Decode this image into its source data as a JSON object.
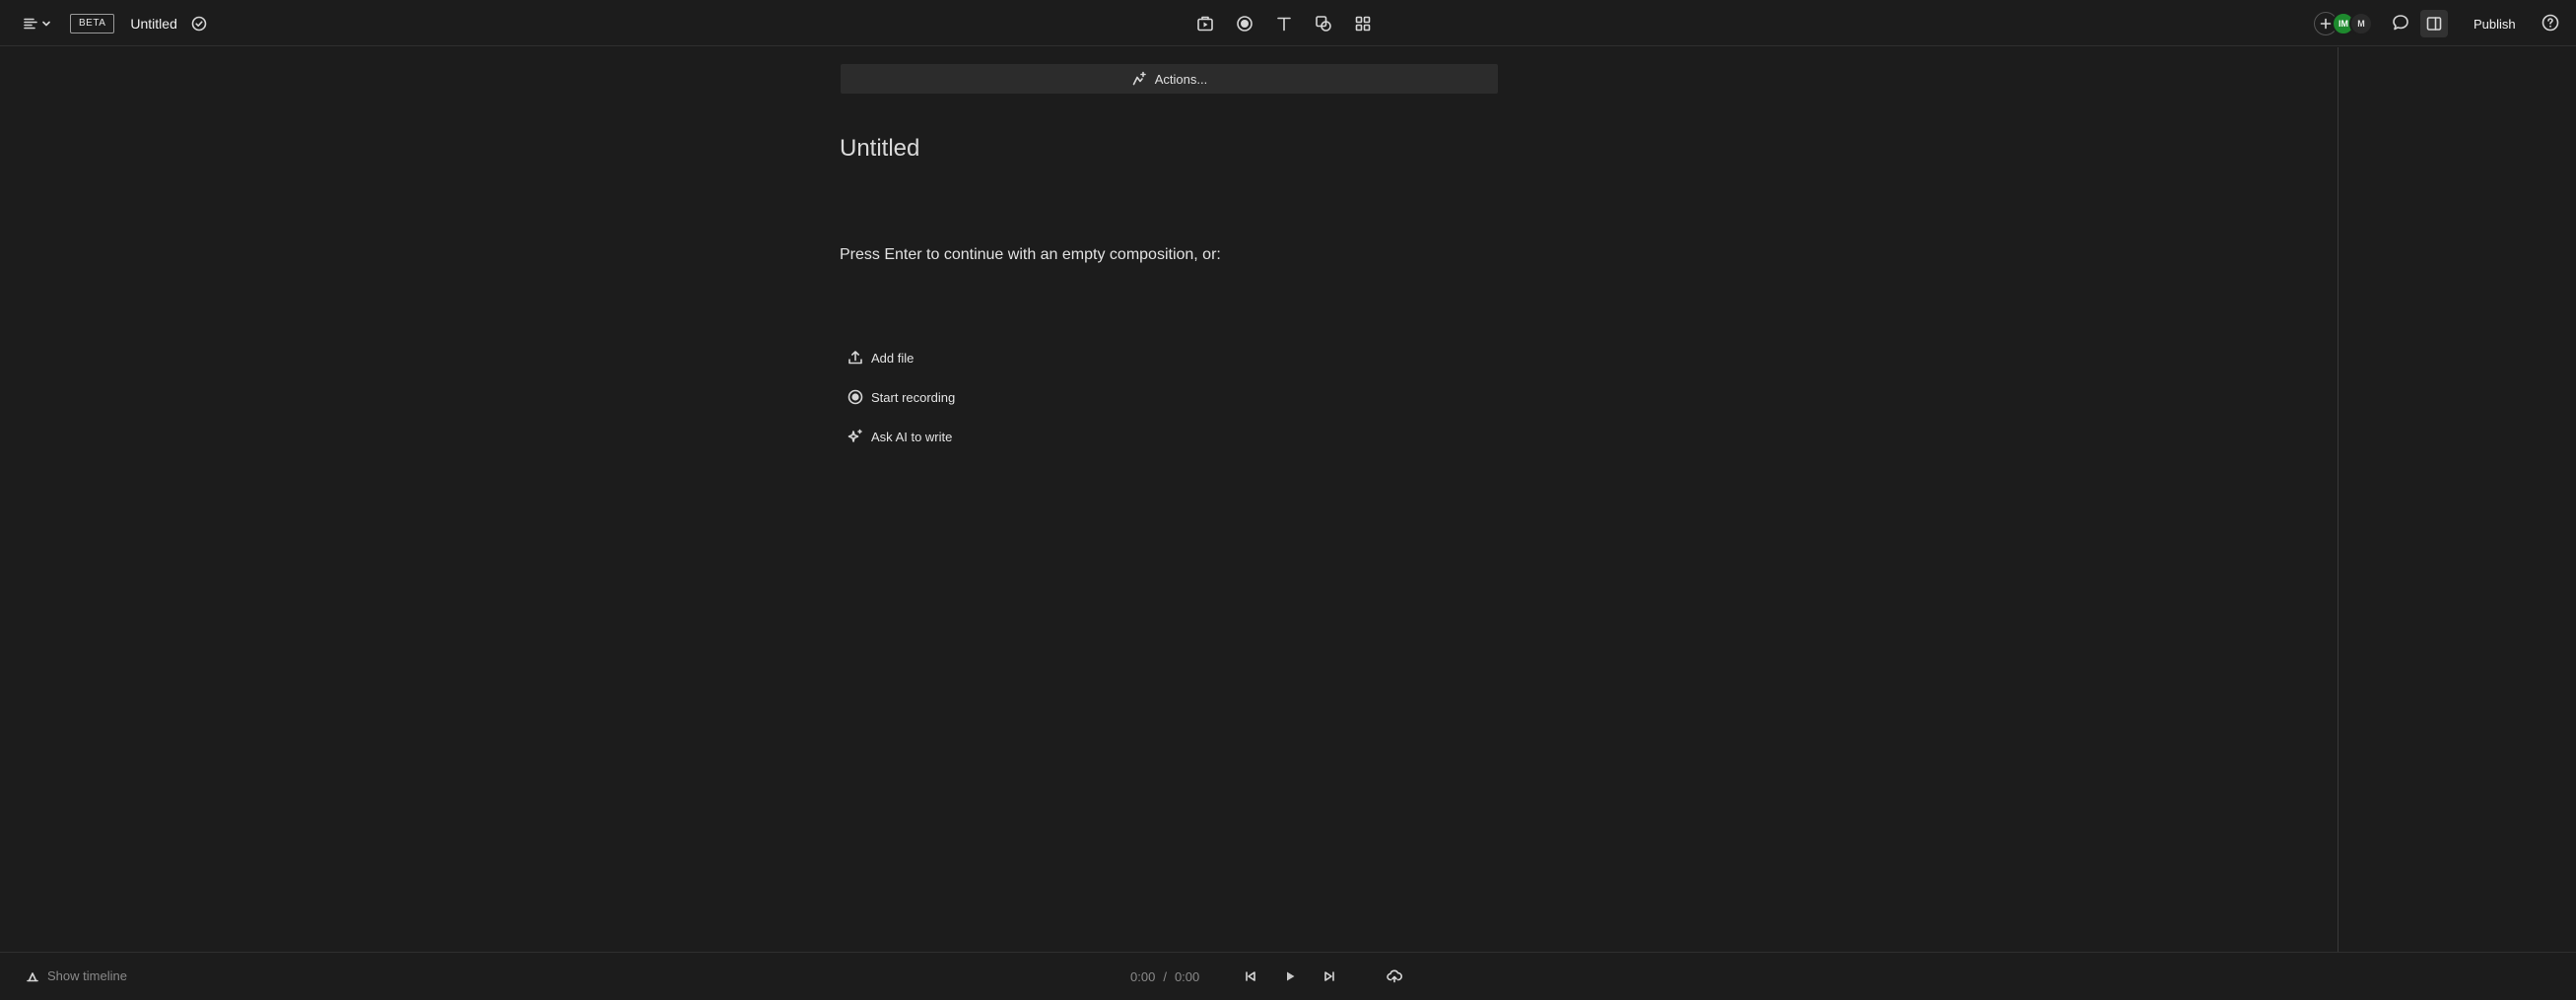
{
  "header": {
    "menu_icon": "menu-lines-icon",
    "beta_label": "BETA",
    "title": "Untitled",
    "saved_icon": "check-circle-icon",
    "tools": [
      {
        "name": "media-icon"
      },
      {
        "name": "record-icon"
      },
      {
        "name": "text-icon"
      },
      {
        "name": "shapes-icon"
      },
      {
        "name": "grid-icon"
      }
    ],
    "collaborators": [
      {
        "initials": "IM",
        "color": "#1e8a2e"
      },
      {
        "initials": "M",
        "color": "#2a2a2a"
      }
    ],
    "publish_label": "Publish"
  },
  "editor": {
    "actions_label": "Actions...",
    "heading": "Untitled",
    "prompt": "Press Enter to continue with an empty composition, or:",
    "options": [
      {
        "label": "Add file",
        "icon": "upload-icon"
      },
      {
        "label": "Start recording",
        "icon": "record-icon"
      },
      {
        "label": "Ask AI to write",
        "icon": "sparkle-icon"
      }
    ]
  },
  "footer": {
    "show_timeline_label": "Show timeline",
    "current_time": "0:00",
    "separator": "/",
    "total_time": "0:00"
  }
}
